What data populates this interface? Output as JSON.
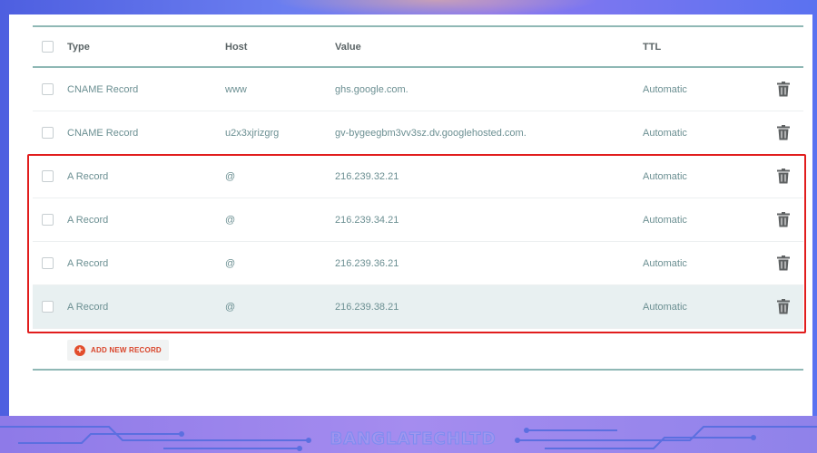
{
  "table": {
    "headers": {
      "type": "Type",
      "host": "Host",
      "value": "Value",
      "ttl": "TTL"
    },
    "rows": [
      {
        "type": "CNAME Record",
        "host": "www",
        "value": "ghs.google.com.",
        "ttl": "Automatic"
      },
      {
        "type": "CNAME Record",
        "host": "u2x3xjrizgrg",
        "value": "gv-bygeegbm3vv3sz.dv.googlehosted.com.",
        "ttl": "Automatic"
      },
      {
        "type": "A Record",
        "host": "@",
        "value": "216.239.32.21",
        "ttl": "Automatic"
      },
      {
        "type": "A Record",
        "host": "@",
        "value": "216.239.34.21",
        "ttl": "Automatic"
      },
      {
        "type": "A Record",
        "host": "@",
        "value": "216.239.36.21",
        "ttl": "Automatic"
      },
      {
        "type": "A Record",
        "host": "@",
        "value": "216.239.38.21",
        "ttl": "Automatic"
      }
    ]
  },
  "actions": {
    "add_record_label": "ADD NEW RECORD"
  },
  "footer": {
    "watermark": "BANGLATECHLTD"
  },
  "icons": {
    "row_delete": "trash-icon",
    "add": "plus-circle-icon"
  },
  "colors": {
    "accent": "#e24d2c",
    "rule": "#8fb8b5",
    "highlight_box": "#e11d1d",
    "text": "#6b8f92"
  }
}
